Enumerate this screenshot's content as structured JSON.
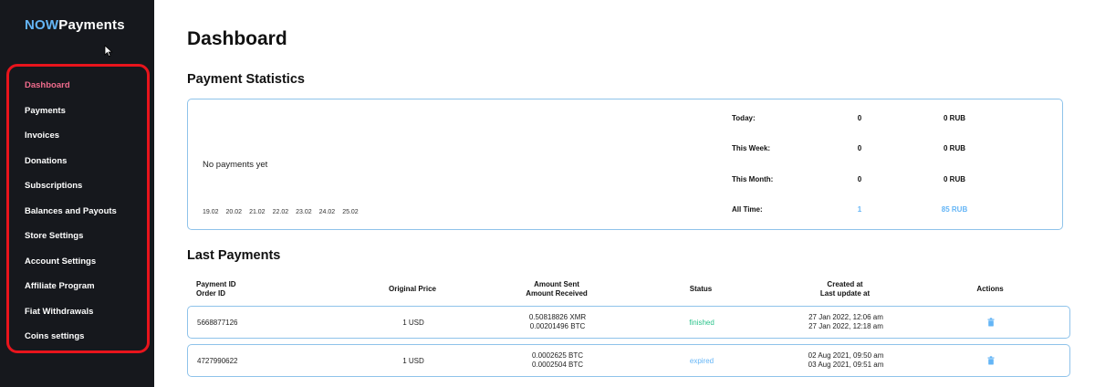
{
  "brand": {
    "now": "NOW",
    "payments": "Payments"
  },
  "sidebar": {
    "items": [
      {
        "label": "Dashboard",
        "active": true
      },
      {
        "label": "Payments"
      },
      {
        "label": "Invoices"
      },
      {
        "label": "Donations"
      },
      {
        "label": "Subscriptions"
      },
      {
        "label": "Balances and Payouts"
      },
      {
        "label": "Store Settings"
      },
      {
        "label": "Account Settings"
      },
      {
        "label": "Affiliate Program"
      },
      {
        "label": "Fiat Withdrawals"
      },
      {
        "label": "Coins settings"
      }
    ]
  },
  "page": {
    "title": "Dashboard"
  },
  "stats": {
    "title": "Payment Statistics",
    "empty_text": "No payments yet",
    "x_ticks": [
      "19.02",
      "20.02",
      "21.02",
      "22.02",
      "23.02",
      "24.02",
      "25.02"
    ],
    "rows": [
      {
        "label": "Today:",
        "count": "0",
        "amount": "0 RUB"
      },
      {
        "label": "This Week:",
        "count": "0",
        "amount": "0 RUB"
      },
      {
        "label": "This Month:",
        "count": "0",
        "amount": "0 RUB"
      },
      {
        "label": "All Time:",
        "count": "1",
        "amount": "85 RUB"
      }
    ]
  },
  "last_payments": {
    "title": "Last Payments",
    "headers": {
      "payment_id": "Payment ID",
      "order_id": "Order ID",
      "original_price": "Original Price",
      "amount_sent": "Amount Sent",
      "amount_received": "Amount Received",
      "status": "Status",
      "created_at": "Created at",
      "last_update": "Last update at",
      "actions": "Actions"
    },
    "rows": [
      {
        "id": "5668877126",
        "price": "1 USD",
        "sent": "0.50818826 XMR",
        "received": "0.00201496 BTC",
        "status": "finished",
        "created": "27 Jan 2022, 12:06 am",
        "updated": "27 Jan 2022, 12:18 am"
      },
      {
        "id": "4727990622",
        "price": "1 USD",
        "sent": "0.0002625 BTC",
        "received": "0.0002504 BTC",
        "status": "expired",
        "created": "02 Aug 2021, 09:50 am",
        "updated": "03 Aug 2021, 09:51 am"
      }
    ]
  },
  "colors": {
    "sidebar_bg": "#16181d",
    "brand_accent": "#64b5f6",
    "active_nav": "#ef6b8c",
    "highlight_border": "#e8141c",
    "card_border": "#8fc3ea",
    "status_finished": "#2bc38b",
    "status_expired": "#64b5f6"
  }
}
